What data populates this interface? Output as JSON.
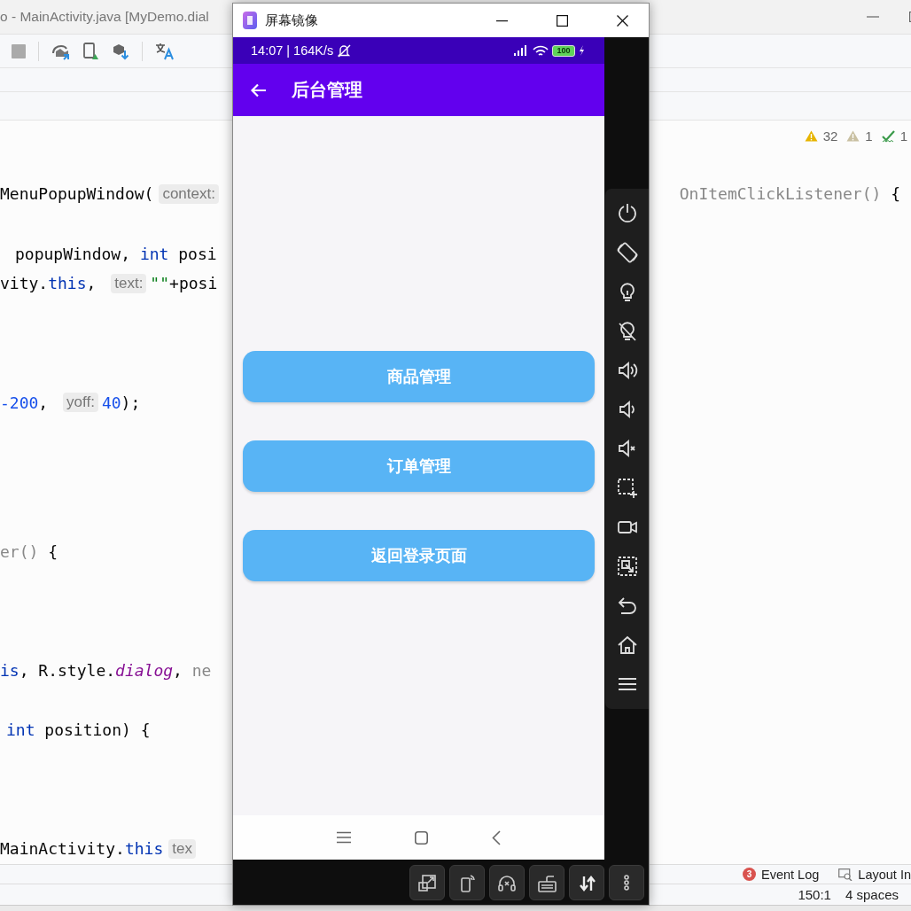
{
  "ide": {
    "title": "o - MainActivity.java [MyDemo.dial",
    "inspections": [
      {
        "kind": "warning",
        "count": "32"
      },
      {
        "kind": "weak_warning",
        "count": "1"
      },
      {
        "kind": "typo",
        "count": "1"
      }
    ],
    "code_lines": [
      {
        "tokens": [
          {
            "kind": "plain",
            "text": "MenuPopupWindow("
          },
          {
            "kind": "hint",
            "text": "context:"
          }
        ],
        "right_tokens": [
          {
            "kind": "muted",
            "text": "OnItemClickListener()"
          },
          {
            "kind": "plain",
            "text": " {"
          }
        ]
      },
      {
        "tokens": [
          {
            "kind": "plain",
            "text": "popupWindow, "
          },
          {
            "kind": "keyword",
            "text": "int"
          },
          {
            "kind": "plain",
            "text": " posi"
          }
        ]
      },
      {
        "tokens": [
          {
            "kind": "plain",
            "text": "vity."
          },
          {
            "kind": "keyword",
            "text": "this"
          },
          {
            "kind": "plain",
            "text": ", "
          },
          {
            "kind": "hint",
            "text": "text:"
          },
          {
            "kind": "string",
            "text": "\"\""
          },
          {
            "kind": "plain",
            "text": "+posi"
          }
        ]
      },
      {
        "tokens": [
          {
            "kind": "number",
            "text": "-200"
          },
          {
            "kind": "plain",
            "text": ", "
          },
          {
            "kind": "hint",
            "text": "yoff:"
          },
          {
            "kind": "number",
            "text": "40"
          },
          {
            "kind": "plain",
            "text": ");"
          }
        ]
      },
      {
        "tokens": [
          {
            "kind": "muted",
            "text": "er()"
          },
          {
            "kind": "plain",
            "text": " {"
          }
        ]
      },
      {
        "tokens": [
          {
            "kind": "keyword",
            "text": "is"
          },
          {
            "kind": "plain",
            "text": ", R.style."
          },
          {
            "kind": "field",
            "text": "dialog"
          },
          {
            "kind": "plain",
            "text": ", "
          },
          {
            "kind": "muted",
            "text": "ne"
          }
        ]
      },
      {
        "tokens": [
          {
            "kind": "keyword",
            "text": "int"
          },
          {
            "kind": "plain",
            "text": " position) {"
          }
        ]
      },
      {
        "tokens": [
          {
            "kind": "plain",
            "text": "MainActivity."
          },
          {
            "kind": "keyword",
            "text": "this"
          },
          {
            "kind": "hint",
            "text": "tex"
          }
        ]
      }
    ],
    "tool_windows": [
      {
        "kind": "event_log",
        "label": "Event Log",
        "badge": "3"
      },
      {
        "kind": "layout_inspector",
        "label": "Layout In"
      }
    ],
    "status_bar": [
      "150:1",
      "4 spaces"
    ]
  },
  "mirror": {
    "title": "屏幕镜像",
    "phone": {
      "status": {
        "time": "14:07 | 164K/s",
        "battery": "100"
      },
      "app_bar": {
        "title": "后台管理"
      },
      "buttons": [
        "商品管理",
        "订单管理",
        "返回登录页面"
      ]
    }
  }
}
